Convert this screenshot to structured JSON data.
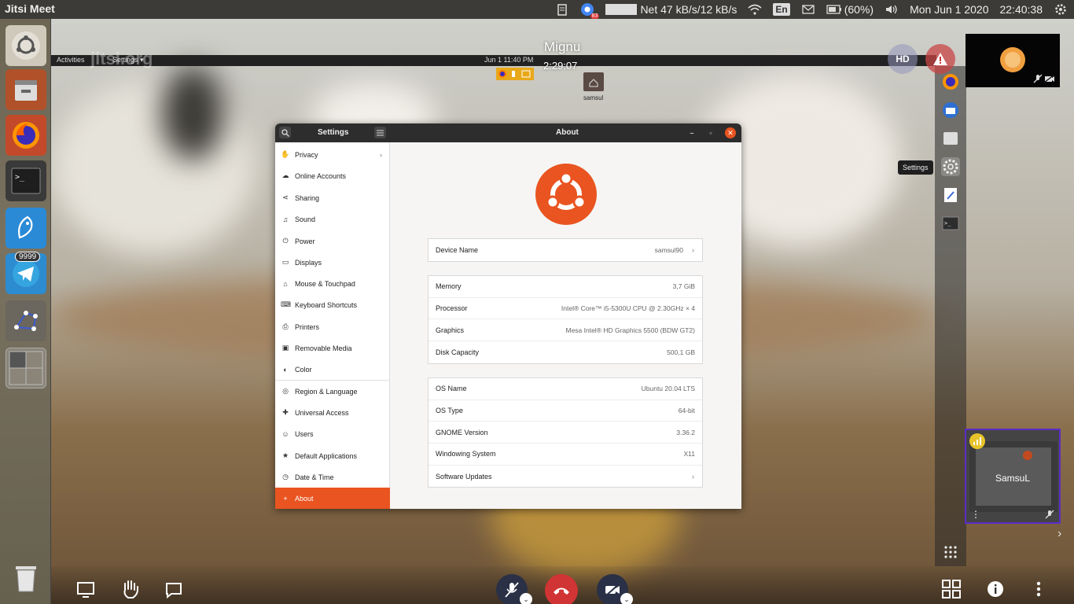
{
  "topbar": {
    "app_title": "Jitsi Meet",
    "notification_count": "83",
    "network": "Net 47 kB/s/12 kB/s",
    "keyboard_lang": "En",
    "battery": "(60%)",
    "date": "Mon Jun  1 2020",
    "time": "22:40:38"
  },
  "launcher": {
    "telegram_badge": "9999"
  },
  "call": {
    "name": "Mignu",
    "timer": "2:29:07",
    "watermark": "jitsi.org",
    "hd_label": "HD",
    "remote_name": "SamsuL"
  },
  "shared_screen": {
    "activities": "Activities",
    "settings_menu": "Settings ▾",
    "clock": "Jun 1  11:40 PM",
    "desktop_folder": "samsul",
    "dock_tooltip": "Settings"
  },
  "settings_window": {
    "left_title": "Settings",
    "right_title": "About",
    "sidebar": [
      {
        "label": "Privacy",
        "icon": "hand-icon"
      },
      {
        "label": "Online Accounts",
        "icon": "cloud-icon"
      },
      {
        "label": "Sharing",
        "icon": "share-icon"
      },
      {
        "label": "Sound",
        "icon": "music-note-icon"
      },
      {
        "label": "Power",
        "icon": "power-icon"
      },
      {
        "label": "Displays",
        "icon": "display-icon"
      },
      {
        "label": "Mouse & Touchpad",
        "icon": "mouse-icon"
      },
      {
        "label": "Keyboard Shortcuts",
        "icon": "keyboard-icon"
      },
      {
        "label": "Printers",
        "icon": "printer-icon"
      },
      {
        "label": "Removable Media",
        "icon": "media-icon"
      },
      {
        "label": "Color",
        "icon": "color-icon"
      },
      {
        "label": "Region & Language",
        "icon": "globe-icon"
      },
      {
        "label": "Universal Access",
        "icon": "accessibility-icon"
      },
      {
        "label": "Users",
        "icon": "user-icon"
      },
      {
        "label": "Default Applications",
        "icon": "star-icon"
      },
      {
        "label": "Date & Time",
        "icon": "clock-icon"
      },
      {
        "label": "About",
        "icon": "plus-icon"
      }
    ],
    "device": {
      "label": "Device Name",
      "value": "samsul90"
    },
    "hardware": [
      {
        "label": "Memory",
        "value": "3,7 GiB"
      },
      {
        "label": "Processor",
        "value": "Intel® Core™ i5-5300U CPU @ 2.30GHz × 4"
      },
      {
        "label": "Graphics",
        "value": "Mesa Intel® HD Graphics 5500 (BDW GT2)"
      },
      {
        "label": "Disk Capacity",
        "value": "500,1 GB"
      }
    ],
    "software": [
      {
        "label": "OS Name",
        "value": "Ubuntu 20.04 LTS"
      },
      {
        "label": "OS Type",
        "value": "64-bit"
      },
      {
        "label": "GNOME Version",
        "value": "3.36.2"
      },
      {
        "label": "Windowing System",
        "value": "X11"
      },
      {
        "label": "Software Updates",
        "value": ""
      }
    ]
  },
  "colors": {
    "ubuntu_orange": "#e95420",
    "hangup_red": "#d03434",
    "thumb_border": "#5b2cc7"
  }
}
